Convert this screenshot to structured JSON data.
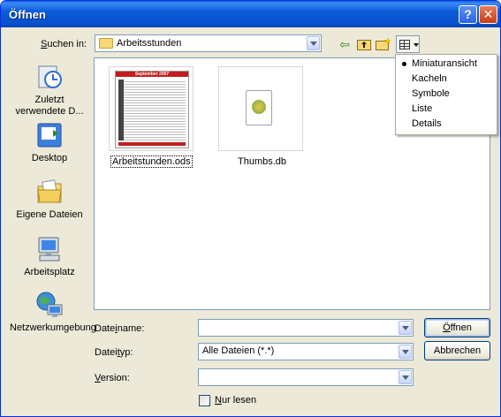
{
  "window": {
    "title": "Öffnen",
    "help_label": "?",
    "close_label": "✕"
  },
  "lookin": {
    "label_prefix": "",
    "label_mnemonic": "S",
    "label_rest": "uchen in:",
    "value": "Arbeitsstunden"
  },
  "toolbar": {
    "back_icon": "⇦",
    "up_icon": "⮤",
    "newfolder_icon": "✱"
  },
  "places": [
    {
      "label": "Zuletzt verwendete D...",
      "icon": "recent-icon"
    },
    {
      "label": "Desktop",
      "icon": "desktop-icon"
    },
    {
      "label": "Eigene Dateien",
      "icon": "my-documents-icon"
    },
    {
      "label": "Arbeitsplatz",
      "icon": "my-computer-icon"
    },
    {
      "label": "Netzwerkumgebung",
      "icon": "network-icon"
    }
  ],
  "files": [
    {
      "name": "Arbeitstunden.ods",
      "thumb_title": "September 2007",
      "selected": true
    },
    {
      "name": "Thumbs.db",
      "selected": false
    }
  ],
  "view_menu": {
    "items": [
      "Miniaturansicht",
      "Kacheln",
      "Symbole",
      "Liste",
      "Details"
    ],
    "checked": "Miniaturansicht"
  },
  "form": {
    "filename_pre": "Date",
    "filename_mn": "i",
    "filename_post": "name:",
    "filename_value": "",
    "filetype_pre": "Datei",
    "filetype_mn": "t",
    "filetype_post": "yp:",
    "filetype_value": "Alle Dateien (*.*)",
    "version_pre": "",
    "version_mn": "V",
    "version_post": "ersion:",
    "version_value": "",
    "readonly_pre": "",
    "readonly_mn": "N",
    "readonly_post": "ur lesen"
  },
  "buttons": {
    "open_pre": "",
    "open_mn": "Ö",
    "open_post": "ffnen",
    "cancel": "Abbrechen"
  }
}
